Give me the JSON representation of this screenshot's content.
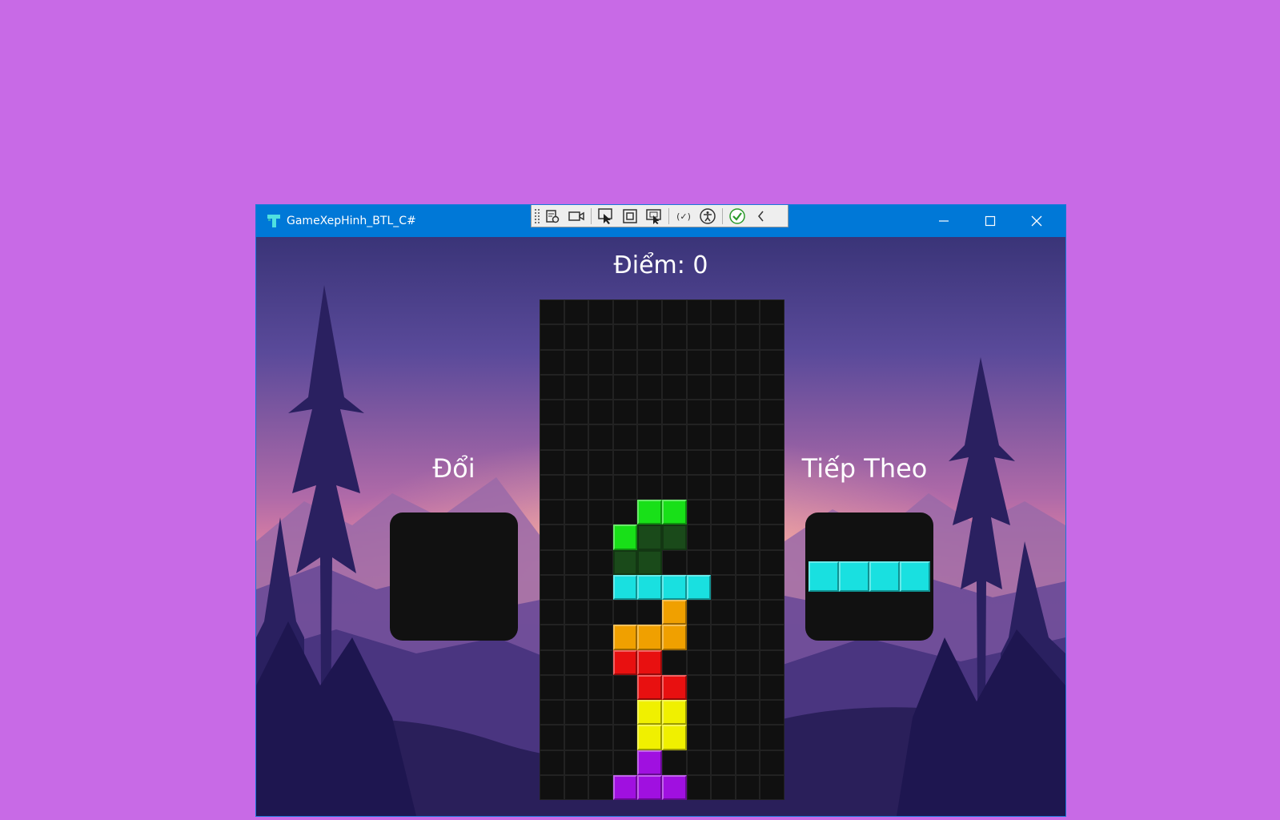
{
  "window": {
    "title": "GameXepHinh_BTL_C#"
  },
  "game": {
    "score_label": "Điểm: 0",
    "hold_label": "Đổi",
    "next_label": "Tiếp Theo",
    "board_cols": 10,
    "board_rows": 20,
    "blocks": [
      {
        "col": 4,
        "row": 8,
        "color": "#18e018"
      },
      {
        "col": 5,
        "row": 8,
        "color": "#18e018"
      },
      {
        "col": 3,
        "row": 9,
        "color": "#18e018"
      },
      {
        "col": 4,
        "row": 9,
        "color": "#1a4a1a",
        "ghost": true
      },
      {
        "col": 5,
        "row": 9,
        "color": "#1a4a1a",
        "ghost": true
      },
      {
        "col": 3,
        "row": 10,
        "color": "#1a4a1a",
        "ghost": true
      },
      {
        "col": 4,
        "row": 10,
        "color": "#1a4a1a",
        "ghost": true
      },
      {
        "col": 3,
        "row": 11,
        "color": "#19e0e0"
      },
      {
        "col": 4,
        "row": 11,
        "color": "#19e0e0"
      },
      {
        "col": 5,
        "row": 11,
        "color": "#19e0e0"
      },
      {
        "col": 6,
        "row": 11,
        "color": "#19e0e0"
      },
      {
        "col": 5,
        "row": 12,
        "color": "#f0a000"
      },
      {
        "col": 3,
        "row": 13,
        "color": "#f0a000"
      },
      {
        "col": 4,
        "row": 13,
        "color": "#f0a000"
      },
      {
        "col": 5,
        "row": 13,
        "color": "#f0a000"
      },
      {
        "col": 3,
        "row": 14,
        "color": "#e81010"
      },
      {
        "col": 4,
        "row": 14,
        "color": "#e81010"
      },
      {
        "col": 4,
        "row": 15,
        "color": "#e81010"
      },
      {
        "col": 5,
        "row": 15,
        "color": "#e81010"
      },
      {
        "col": 4,
        "row": 16,
        "color": "#f0f000"
      },
      {
        "col": 5,
        "row": 16,
        "color": "#f0f000"
      },
      {
        "col": 4,
        "row": 17,
        "color": "#f0f000"
      },
      {
        "col": 5,
        "row": 17,
        "color": "#f0f000"
      },
      {
        "col": 4,
        "row": 18,
        "color": "#a010e0"
      },
      {
        "col": 3,
        "row": 19,
        "color": "#a010e0"
      },
      {
        "col": 4,
        "row": 19,
        "color": "#a010e0"
      },
      {
        "col": 5,
        "row": 19,
        "color": "#a010e0"
      }
    ],
    "next_piece": {
      "type": "I",
      "color": "#19e0e0"
    },
    "hold_piece": null
  }
}
